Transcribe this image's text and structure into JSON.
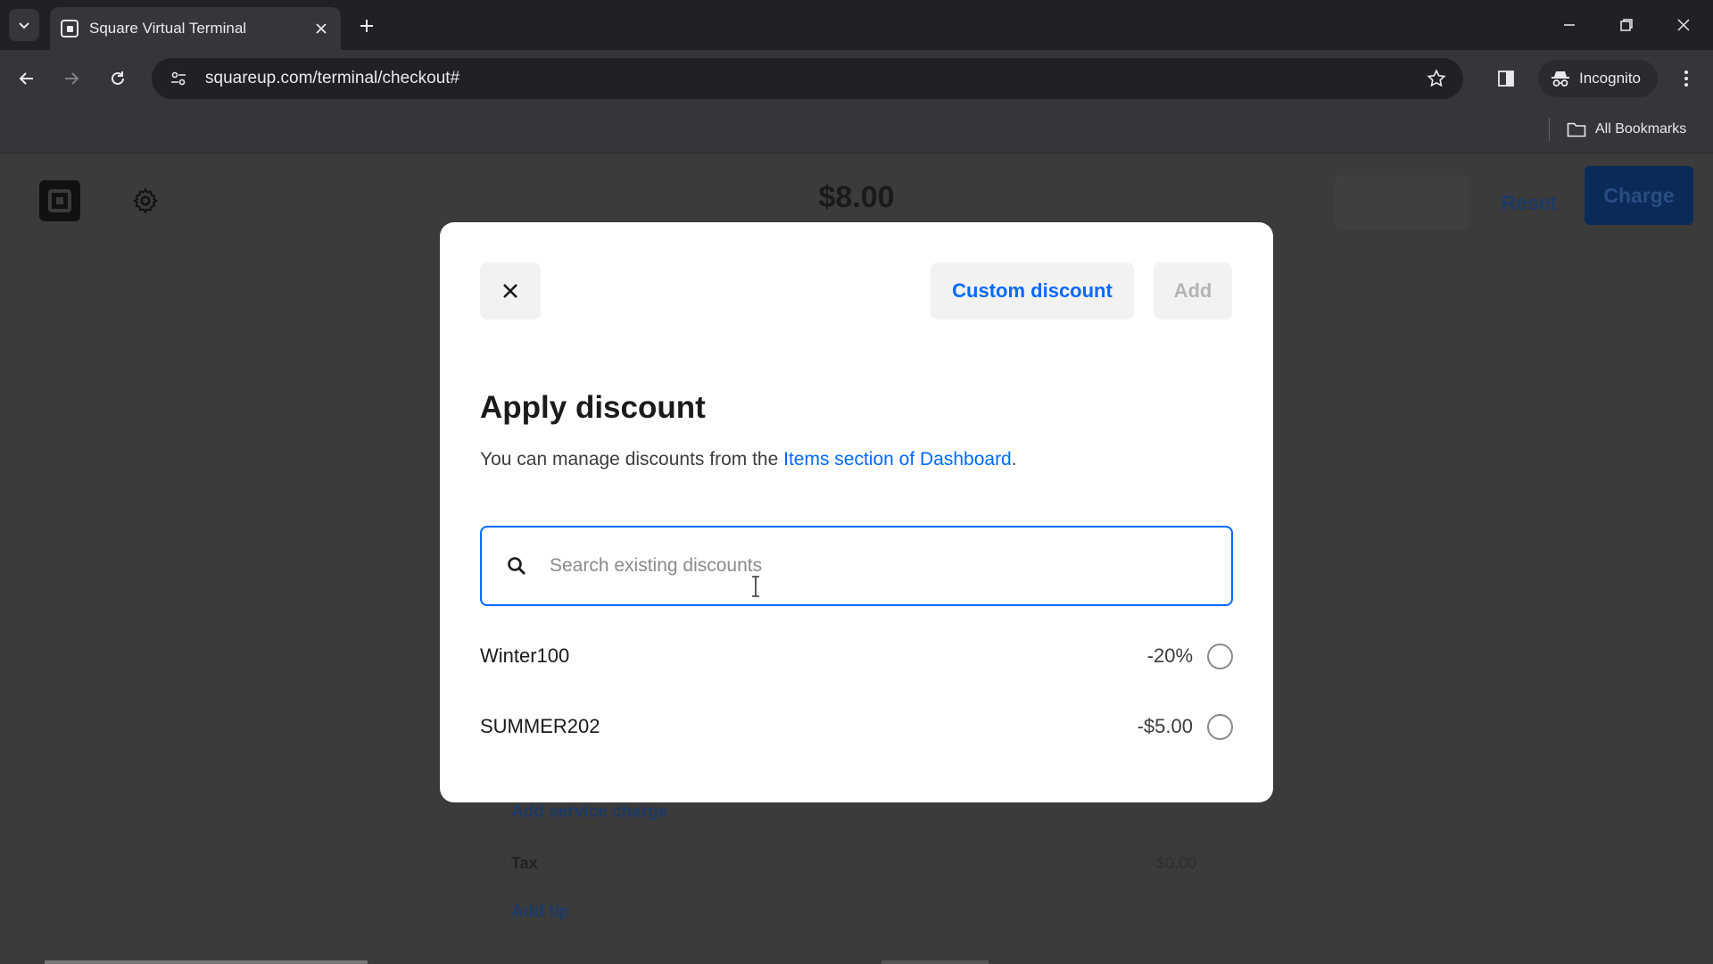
{
  "browser": {
    "tab_title": "Square Virtual Terminal",
    "url": "squareup.com/terminal/checkout#",
    "incognito_label": "Incognito",
    "all_bookmarks_label": "All Bookmarks"
  },
  "page": {
    "total": "$8.00",
    "reset_label": "Reset",
    "charge_label": "Charge",
    "add_service_charge_label": "Add service charge",
    "tax_label": "Tax",
    "tax_value": "$0.00",
    "add_tip_label": "Add tip"
  },
  "modal": {
    "custom_discount_label": "Custom discount",
    "add_label": "Add",
    "title": "Apply discount",
    "help_prefix": "You can manage discounts from the ",
    "help_link": "Items section of Dashboard",
    "help_suffix": ".",
    "search_placeholder": "Search existing discounts",
    "search_value": "",
    "discounts": [
      {
        "name": "Winter100",
        "amount": "-20%",
        "selected": false
      },
      {
        "name": "SUMMER202",
        "amount": "-$5.00",
        "selected": false
      }
    ]
  },
  "colors": {
    "accent": "#006aff",
    "disabled_text": "#b4b4b4",
    "overlay": "#3b3b3b"
  }
}
